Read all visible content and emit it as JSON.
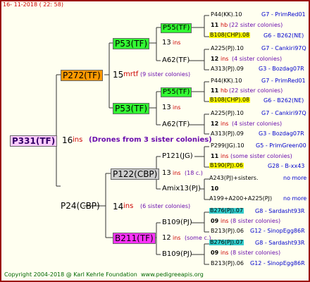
{
  "header": {
    "date": "16- 11-2018 ( 22: 58)"
  },
  "footer": {
    "copyright": "Copyright 2004-2018 @ Karl Kehrle Foundation",
    "url": "www.pedigreeapis.org"
  },
  "colors": {
    "frame": "#9b0e0e",
    "background": "#fffff0",
    "root_box": "#ffccff",
    "orange_box": "#ff9900",
    "green_box": "#33ff33",
    "gray_box": "#cccccc",
    "magenta_box": "#ff33ff",
    "yellow_box": "#ffff00",
    "cyan_box": "#33cccc"
  },
  "root": {
    "name": "P331(TF)",
    "gen": "16",
    "ins": "ins",
    "note": "(Drones from 3 sister colonies)"
  },
  "g1": [
    {
      "name": "P272(TF)",
      "gen": "15",
      "ins": "mrtf",
      "note": "(9 sister colonies)"
    },
    {
      "name": "P24(CBP)",
      "gen": "14",
      "ins": "ins",
      "note": "(6 sister colonies)"
    }
  ],
  "g2": [
    {
      "name": "P53(TF)",
      "gen": "13",
      "ins": "ins"
    },
    {
      "name": "P53(TF)",
      "gen": "13",
      "ins": "ins"
    },
    {
      "name": "P122(CBP)",
      "gen": "13",
      "ins": "ins",
      "note": "(18 c.)"
    },
    {
      "name": "B211(TF)",
      "gen": "12",
      "ins": "ins",
      "note": "(some c.)"
    }
  ],
  "g3": [
    {
      "name": "P55(TF)"
    },
    {
      "name": "A62(TF)"
    },
    {
      "name": "P55(TF)"
    },
    {
      "name": "A62(TF)"
    },
    {
      "name": "P121(JG)"
    },
    {
      "name": "Amix13(PJ)"
    },
    {
      "name": "B109(PJ)"
    },
    {
      "name": "B109(PJ)"
    }
  ],
  "g4": [
    {
      "top": "P44(KK).10",
      "top_note": "G7 - PrimRed01",
      "gen": "11",
      "ins": "hb",
      "note": "(22 sister colonies)",
      "bottom": "B108(CHP).08",
      "bottom_note": "G6 - B262(NE)"
    },
    {
      "top": "A225(PJ).10",
      "top_note": "G7 - Cankiri97Q",
      "gen": "12",
      "ins": "ins",
      "note": "(4 sister colonies)",
      "bottom": "A313(PJ).09",
      "bottom_note": "G3 - Bozdag07R"
    },
    {
      "top": "P44(KK).10",
      "top_note": "G7 - PrimRed01",
      "gen": "11",
      "ins": "hb",
      "note": "(22 sister colonies)",
      "bottom": "B108(CHP).08",
      "bottom_note": "G6 - B262(NE)"
    },
    {
      "top": "A225(PJ).10",
      "top_note": "G7 - Cankiri97Q",
      "gen": "12",
      "ins": "ins",
      "note": "(4 sister colonies)",
      "bottom": "A313(PJ).09",
      "bottom_note": "G3 - Bozdag07R"
    },
    {
      "top": "P299(JG).10",
      "top_note": "G5 - PrimGreen00",
      "gen": "11",
      "ins": "ins",
      "note": "(some sister colonies)",
      "bottom": "B190(PJ).06",
      "bottom_note": "G28 - B-xx43"
    },
    {
      "top": "A243(PJ)+sisters.",
      "top_note": "no more",
      "gen": "10",
      "ins": "",
      "note": "",
      "bottom": "A199+A200+A225(PJ)",
      "bottom_note": "no more"
    },
    {
      "top": "B276(PJ).07",
      "top_note": "G8 - Sardasht93R",
      "gen": "09",
      "ins": "ins",
      "note": "(8 sister colonies)",
      "bottom": "B213(PJ).06",
      "bottom_note": "G12 - SinopEgg86R"
    },
    {
      "top": "B276(PJ).07",
      "top_note": "G8 - Sardasht93R",
      "gen": "09",
      "ins": "ins",
      "note": "(8 sister colonies)",
      "bottom": "B213(PJ).06",
      "bottom_note": "G12 - SinopEgg86R"
    }
  ]
}
